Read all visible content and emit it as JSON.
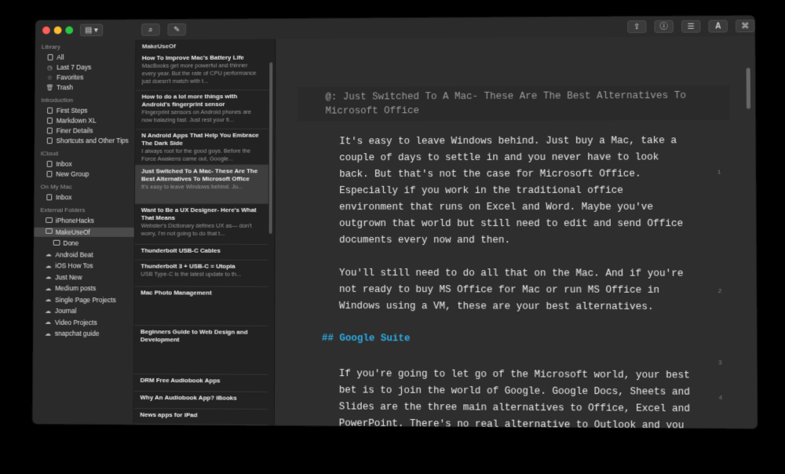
{
  "window": {
    "buttons": {
      "close": "#ff5f57",
      "minimize": "#febc2e",
      "maximize": "#28c840"
    }
  },
  "toolbar": {
    "left": [
      {
        "name": "sidebar-toggle-icon",
        "glyph": "▤ ▾"
      },
      {
        "name": "search-icon",
        "glyph": "⌕"
      },
      {
        "name": "compose-icon",
        "glyph": "✎"
      }
    ],
    "right": [
      {
        "name": "share-icon",
        "glyph": "⇪"
      },
      {
        "name": "info-icon",
        "glyph": "ⓘ"
      },
      {
        "name": "list-icon",
        "glyph": "☰"
      },
      {
        "name": "font-icon",
        "glyph": "A"
      },
      {
        "name": "tag-icon",
        "glyph": "⌘"
      }
    ]
  },
  "sidebar": {
    "sections": [
      {
        "label": "Library",
        "items": [
          {
            "label": "All",
            "icon": "doc"
          },
          {
            "label": "Last 7 Days",
            "icon": "clock"
          },
          {
            "label": "Favorites",
            "icon": "star"
          },
          {
            "label": "Trash",
            "icon": "trash"
          }
        ]
      },
      {
        "label": "Introduction",
        "items": [
          {
            "label": "First Steps",
            "icon": "doc"
          },
          {
            "label": "Markdown XL",
            "icon": "doc"
          },
          {
            "label": "Finer Details",
            "icon": "doc"
          },
          {
            "label": "Shortcuts and Other Tips",
            "icon": "doc"
          }
        ]
      },
      {
        "label": "iCloud",
        "items": [
          {
            "label": "Inbox",
            "icon": "doc"
          },
          {
            "label": "New Group",
            "icon": "doc"
          }
        ]
      },
      {
        "label": "On My Mac",
        "items": [
          {
            "label": "Inbox",
            "icon": "doc"
          }
        ]
      },
      {
        "label": "External Folders",
        "items": [
          {
            "label": "iPhoneHacks",
            "icon": "folder"
          },
          {
            "label": "MakeUseOf",
            "icon": "folder",
            "selected": true
          },
          {
            "label": "Done",
            "icon": "folder"
          },
          {
            "label": "Android Beat",
            "icon": "cloud"
          },
          {
            "label": "iOS How Tos",
            "icon": "cloud"
          },
          {
            "label": "Just New",
            "icon": "cloud"
          },
          {
            "label": "Medium posts",
            "icon": "cloud"
          },
          {
            "label": "Single Page Projects",
            "icon": "cloud"
          },
          {
            "label": "Journal",
            "icon": "cloud"
          },
          {
            "label": "Video Projects",
            "icon": "cloud"
          },
          {
            "label": "snapchat guide",
            "icon": "cloud"
          }
        ]
      }
    ]
  },
  "notes": {
    "folder": "MakeUseOf",
    "items": [
      {
        "title": "How To Improve Mac's Battery Life",
        "preview": "MacBooks get more powerful and thinner every year. But the rate of CPU performance just doesn't match with t..."
      },
      {
        "title": "How to do a lot more things with Android's fingerprint sensor",
        "preview": "Fingerprint sensors on Android phones are now balazing fast. Just rest your fi..."
      },
      {
        "title": "N Android Apps That Help You Embrace The Dark Side",
        "preview": "I always root for the good guys. Before the Force Awakens came out, Google..."
      },
      {
        "title": "Just Switched To A Mac- These Are The Best Alternatives To Microsoft Office",
        "preview": "It's easy to leave Windows behind. Ju...",
        "selected": true
      },
      {
        "title": "Want to Be a UX Designer- Here's What That Means",
        "preview": "Webster's Dictionary defines UX as— don't worry, I'm not going to do that t..."
      },
      {
        "title": "Thunderbolt USB-C Cables",
        "preview": ""
      },
      {
        "title": "Thunderbolt 3 + USB-C = Utopia",
        "preview": "USB Type-C is the latest update to th..."
      },
      {
        "title": "Mac Photo Management",
        "preview": ""
      },
      {
        "title": "Beginners Guide to Web Design and Development",
        "preview": ""
      },
      {
        "title": "DRM Free Audiobook Apps",
        "preview": ""
      },
      {
        "title": "Why An Audiobook App? iBooks",
        "preview": ""
      },
      {
        "title": "News apps for iPad",
        "preview": ""
      }
    ]
  },
  "editor": {
    "heading": "@: Just Switched To A Mac- These Are The Best Alternatives To Microsoft Office",
    "paragraphs": [
      "It's easy to leave Windows behind. Just buy a Mac, take a couple of days to settle in and you never have to look back. But that's not the case for Microsoft Office. Especially if you work in the traditional office environment that runs on Excel and Word. Maybe you've outgrown that world but still need to edit and send Office documents every now and then.",
      "You'll still need to do all that on the Mac. And if you're not ready to buy MS Office for Mac or run MS Office in Windows using a VM, these are your best alternatives."
    ],
    "subheading": "## Google Suite",
    "paragraph3": "If you're going to let go of the Microsoft world, your best bet is to join the world of Google. Google Docs, Sheets and Slides are the three main alternatives to Office, Excel and PowerPoint. There's no real alternative to Outlook and you can get OneNote",
    "line_numbers": [
      "1",
      "2",
      "3",
      "4"
    ]
  }
}
